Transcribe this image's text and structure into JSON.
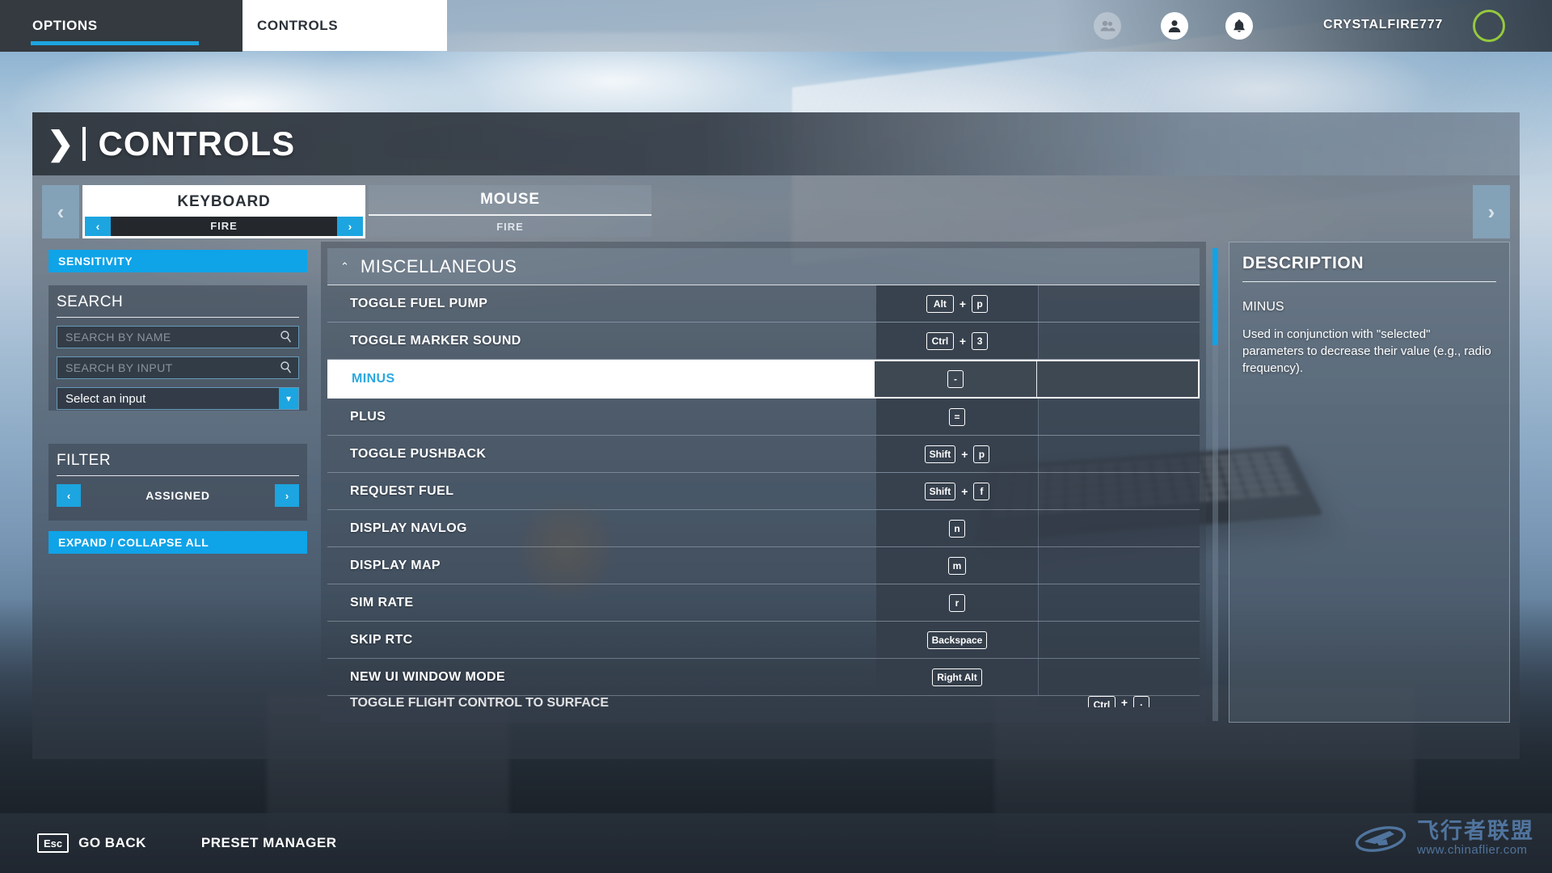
{
  "topbar": {
    "tabs": [
      {
        "label": "OPTIONS",
        "active": false
      },
      {
        "label": "CONTROLS",
        "active": true
      }
    ],
    "icons": {
      "friends": "friends-icon",
      "profile": "profile-icon",
      "bell": "bell-icon"
    },
    "username": "CRYSTALFIRE777"
  },
  "page": {
    "title": "CONTROLS",
    "chevron": "❯"
  },
  "devices": {
    "prev_arrow": "‹",
    "next_arrow": "›",
    "tabs": [
      {
        "name": "KEYBOARD",
        "preset": "FIRE",
        "active": true
      },
      {
        "name": "MOUSE",
        "preset": "FIRE",
        "active": false
      }
    ]
  },
  "sidebar": {
    "sensitivity_label": "SENSITIVITY",
    "search": {
      "heading": "SEARCH",
      "by_name_placeholder": "SEARCH BY NAME",
      "by_name_value": "",
      "by_input_placeholder": "SEARCH BY INPUT",
      "by_input_value": "",
      "select_input_value": "Select an input"
    },
    "filter": {
      "heading": "FILTER",
      "value": "ASSIGNED",
      "prev_arrow": "‹",
      "next_arrow": "›"
    },
    "expand_collapse_label": "EXPAND / COLLAPSE ALL"
  },
  "list": {
    "section_title": "MISCELLANEOUS",
    "section_chevron": "⌃",
    "plus_sign": "+",
    "rows": [
      {
        "name": "TOGGLE FUEL PUMP",
        "keys": [
          "Alt",
          "p"
        ],
        "selected": false
      },
      {
        "name": "TOGGLE MARKER SOUND",
        "keys": [
          "Ctrl",
          "3"
        ],
        "selected": false
      },
      {
        "name": "MINUS",
        "keys": [
          "-"
        ],
        "selected": true
      },
      {
        "name": "PLUS",
        "keys": [
          "="
        ],
        "selected": false
      },
      {
        "name": "TOGGLE PUSHBACK",
        "keys": [
          "Shift",
          "p"
        ],
        "selected": false
      },
      {
        "name": "REQUEST FUEL",
        "keys": [
          "Shift",
          "f"
        ],
        "selected": false
      },
      {
        "name": "DISPLAY NAVLOG",
        "keys": [
          "n"
        ],
        "selected": false
      },
      {
        "name": "DISPLAY MAP",
        "keys": [
          "m"
        ],
        "selected": false
      },
      {
        "name": "SIM RATE",
        "keys": [
          "r"
        ],
        "selected": false
      },
      {
        "name": "SKIP RTC",
        "keys": [
          "Backspace"
        ],
        "selected": false
      },
      {
        "name": "NEW UI WINDOW MODE",
        "keys": [
          "Right Alt"
        ],
        "selected": false
      }
    ],
    "clipped_row": {
      "name": "TOGGLE FLIGHT CONTROL TO SURFACE",
      "keys": [
        "Ctrl",
        "·"
      ]
    }
  },
  "description": {
    "heading": "DESCRIPTION",
    "subject": "MINUS",
    "body": "Used in conjunction with \"selected\" parameters to decrease their value (e.g., radio frequency)."
  },
  "bottombar": {
    "esc_key": "Esc",
    "go_back_label": "GO BACK",
    "preset_manager_label": "PRESET MANAGER"
  },
  "watermark": {
    "cn_text": "飞行者联盟",
    "url": "www.chinaflier.com"
  }
}
